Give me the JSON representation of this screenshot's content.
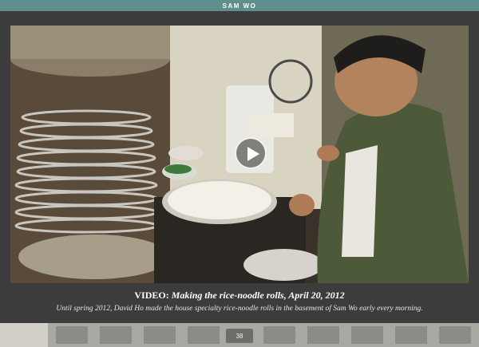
{
  "app": {
    "title": "SAM WO"
  },
  "video": {
    "play_icon": "play-icon",
    "caption_lead": "VIDEO:",
    "caption_title": "Making the rice-noodle rolls, April 20, 2012",
    "caption_body": "Until spring 2012, David Ho made the house specialty rice-noodle rolls in the basement of Sam Wo early every morning."
  },
  "footer": {
    "page_number": "38"
  },
  "colors": {
    "header_bar": "#5e8f8c",
    "stage": "#3c3c3c",
    "footer": "#a9a9a3"
  }
}
